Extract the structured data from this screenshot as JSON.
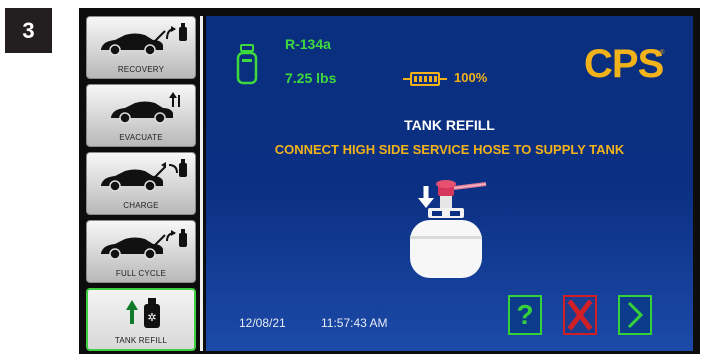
{
  "step_number": "3",
  "menu": {
    "items": [
      {
        "label": "RECOVERY"
      },
      {
        "label": "EVACUATE"
      },
      {
        "label": "CHARGE"
      },
      {
        "label": "FULL CYCLE"
      },
      {
        "label": "TANK REFILL",
        "active": true
      }
    ]
  },
  "status": {
    "refrigerant": "R-134a",
    "tank_weight": "7.25 lbs",
    "battery_percent": "100%",
    "battery_level": 1.0
  },
  "brand": {
    "logo": "CPS",
    "mark": "®"
  },
  "main": {
    "title": "TANK REFILL",
    "instruction": "CONNECT HIGH SIDE SERVICE HOSE TO SUPPLY TANK"
  },
  "footer": {
    "date": "12/08/21",
    "time": "11:57:43 AM"
  },
  "controls": {
    "help_label": "?"
  },
  "colors": {
    "screen_blue": "#0b2f82",
    "accent_green": "#35d13a",
    "accent_yellow": "#f2b31a",
    "cancel_red": "#d21f26"
  },
  "icons": [
    "car-recovery-icon",
    "car-evacuate-icon",
    "car-charge-icon",
    "car-full-cycle-icon",
    "tank-refill-icon",
    "tank-icon",
    "battery-icon",
    "tank-hose-illustration",
    "help-icon",
    "cancel-icon",
    "next-icon"
  ]
}
